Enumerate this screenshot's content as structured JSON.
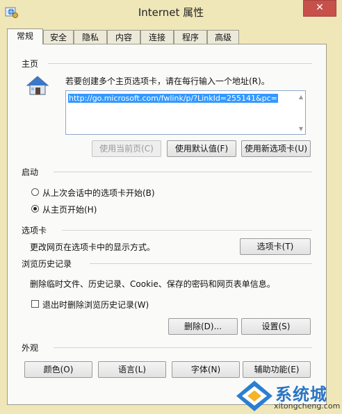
{
  "window": {
    "title": "Internet 属性",
    "close_label": "✕"
  },
  "tabs": [
    "常规",
    "安全",
    "隐私",
    "内容",
    "连接",
    "程序",
    "高级"
  ],
  "home": {
    "section": "主页",
    "instruction": "若要创建多个主页选项卡，请在每行输入一个地址(R)。",
    "url": "http://go.microsoft.com/fwlink/p/?LinkId=255141&pc=",
    "btn_current": "使用当前页(C)",
    "btn_default": "使用默认值(F)",
    "btn_newtab": "使用新选项卡(U)"
  },
  "startup": {
    "section": "启动",
    "option_last": "从上次会话中的选项卡开始(B)",
    "option_home": "从主页开始(H)"
  },
  "tabsec": {
    "section": "选项卡",
    "desc": "更改网页在选项卡中的显示方式。",
    "btn": "选项卡(T)"
  },
  "history": {
    "section": "浏览历史记录",
    "desc": "删除临时文件、历史记录、Cookie、保存的密码和网页表单信息。",
    "checkbox": "退出时删除浏览历史记录(W)",
    "btn_delete": "删除(D)...",
    "btn_settings": "设置(S)"
  },
  "appearance": {
    "section": "外观",
    "btn_colors": "颜色(O)",
    "btn_language": "语言(L)",
    "btn_fonts": "字体(N)",
    "btn_access": "辅助功能(E)"
  },
  "watermark": {
    "brand": "系统城",
    "url": "xitongcheng.com"
  },
  "colors": {
    "chrome": "#f0e7b8",
    "accent": "#3399ff",
    "close": "#c7504b"
  }
}
